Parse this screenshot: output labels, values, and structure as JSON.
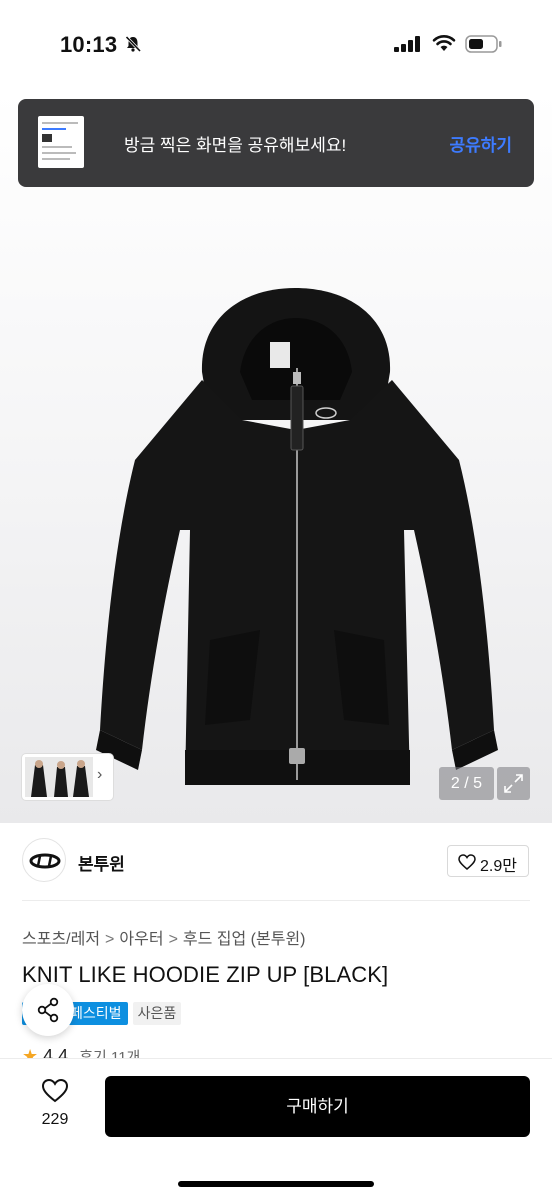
{
  "status_bar": {
    "time": "10:13",
    "icons": [
      "bell-slash-icon",
      "cellular-signal-icon",
      "wifi-icon",
      "battery-icon"
    ]
  },
  "toast": {
    "message": "방금 찍은 화면을 공유해보세요!",
    "action_label": "공유하기",
    "action_color": "#3d7bff"
  },
  "gallery": {
    "counter": "2 / 5",
    "thumbnail_chevron": "›",
    "expand_icon": "expand-icon"
  },
  "brand": {
    "name": "본투윈",
    "like_count": "2.9만"
  },
  "breadcrumb": [
    "스포츠/레저",
    "아우터",
    "후드 집업 (본투윈)"
  ],
  "product": {
    "title": "KNIT LIKE HOODIE ZIP UP [BLACK]",
    "badges": [
      {
        "label": "페스티벌",
        "color": "#0d8fe0"
      },
      {
        "label": "사은품",
        "color": "#f1f1f1"
      }
    ],
    "rating": "4.4",
    "reviews": "후기 11개"
  },
  "bottom_bar": {
    "wish_count": "229",
    "buy_label": "구매하기"
  }
}
